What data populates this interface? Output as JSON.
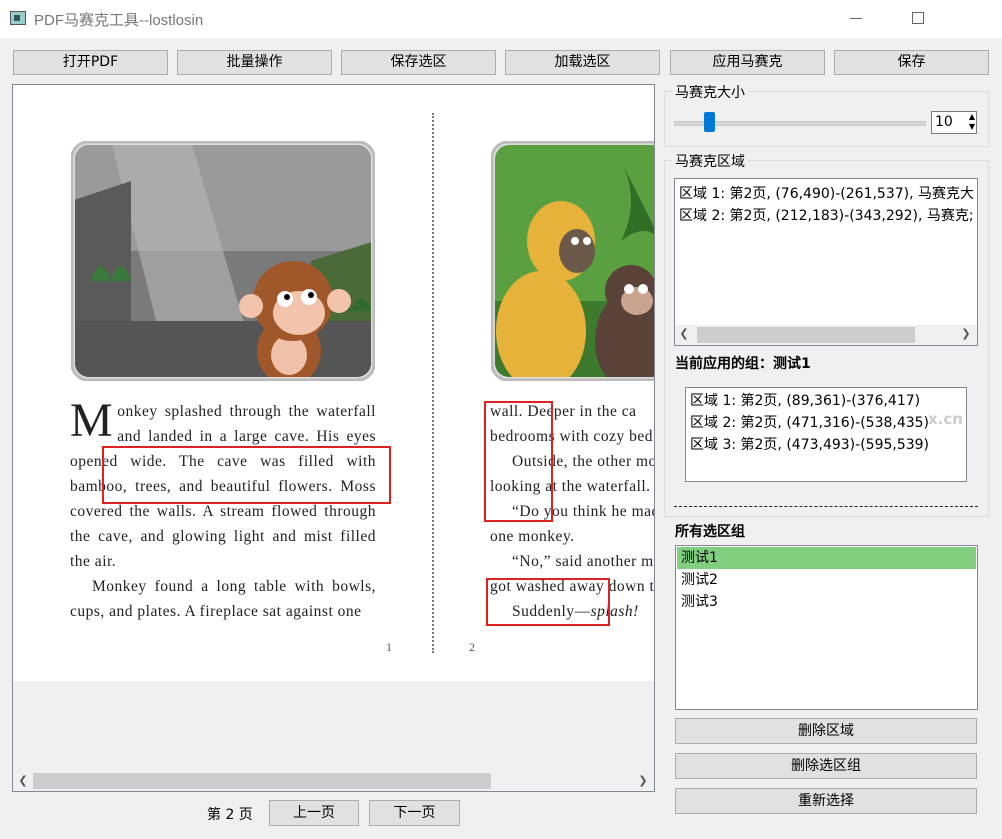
{
  "window": {
    "title": "PDF马赛克工具--lostlosin"
  },
  "toolbar": {
    "open_pdf": "打开PDF",
    "batch": "批量操作",
    "save_selection": "保存选区",
    "load_selection": "加载选区",
    "apply_mosaic": "应用马赛克",
    "save": "保存"
  },
  "book": {
    "left_dropcap": "M",
    "left_para1": "onkey splashed through the waterfall and landed in a large cave. His eyes opened wide. The cave was filled with bamboo, trees, and beautiful flowers. Moss covered the walls. A stream flowed through the cave, and glowing light and mist filled the air.",
    "left_para2": "Monkey found a long table with bowls, cups, and plates. A fireplace sat against one",
    "left_page_num": "1",
    "right_lines": [
      "wall. Deeper in the ca",
      "bedrooms with cozy bed",
      "Outside, the other mo",
      "looking at the waterfall.",
      "“Do you think he mad",
      "one monkey.",
      "“No,” said another m",
      "got washed away down t"
    ],
    "right_sudden": "Suddenly—",
    "right_splash": "splash!",
    "right_page_num": "2"
  },
  "nav": {
    "page_label": "第 2 页",
    "prev": "上一页",
    "next": "下一页"
  },
  "mosaic": {
    "size_label": "马赛克大小",
    "size_value": "10",
    "slider_fraction": 0.12,
    "area_label": "马赛克区域",
    "areas": [
      "区域 1: 第2页, (76,490)-(261,537), 马赛克大",
      "区域 2: 第2页, (212,183)-(343,292), 马赛克;"
    ]
  },
  "current_group": {
    "label": "当前应用的组：测试1",
    "areas": [
      "区域 1: 第2页, (89,361)-(376,417)",
      "区域 2: 第2页, (471,316)-(538,435)",
      "区域 3: 第2页, (473,493)-(595,539)"
    ]
  },
  "all_groups": {
    "label": "所有选区组",
    "items": [
      "测试1",
      "测试2",
      "测试3"
    ],
    "selected_index": 0,
    "selected_color": "#7fcf7f"
  },
  "buttons": {
    "delete_area": "删除区域",
    "delete_group": "删除选区组",
    "reselect": "重新选择"
  },
  "watermark": "x.cn"
}
